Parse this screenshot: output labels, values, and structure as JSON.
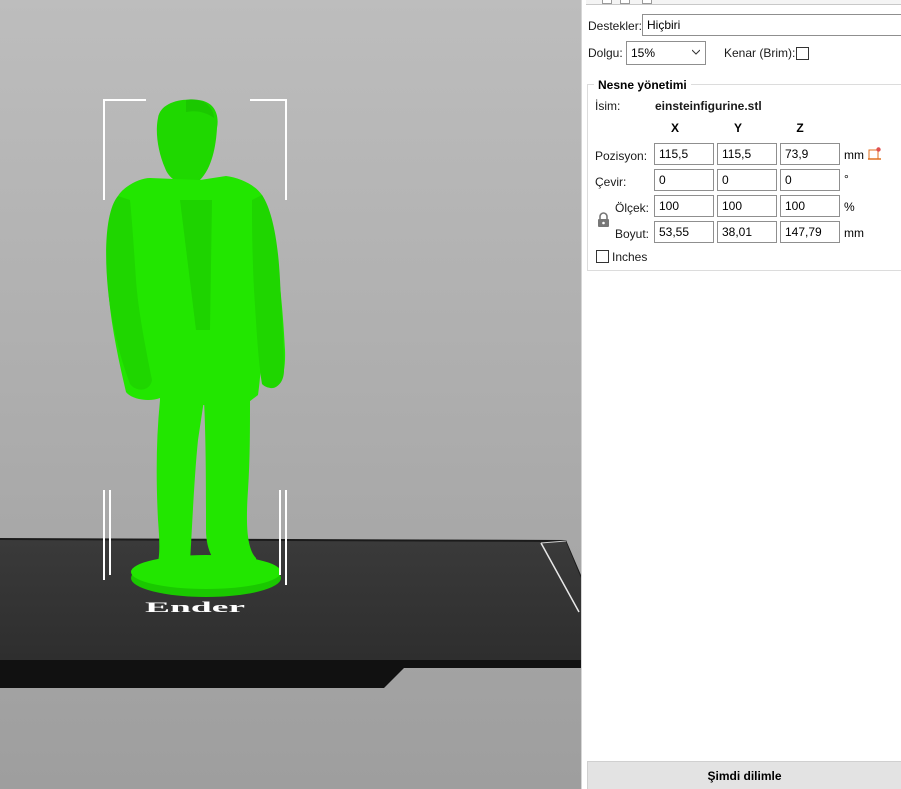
{
  "viewport": {
    "model_color": "#22e600",
    "bed_logo_text": "Ender"
  },
  "panel": {
    "supports": {
      "label": "Destekler:",
      "value": "Hiçbiri"
    },
    "infill": {
      "label": "Dolgu:",
      "value": "15%"
    },
    "brim": {
      "label": "Kenar (Brim):",
      "checked": false
    },
    "object_management": {
      "title": "Nesne yönetimi",
      "name_label": "İsim:",
      "file_name": "einsteinfigurine.stl",
      "axis_headers": [
        "X",
        "Y",
        "Z"
      ],
      "position": {
        "label": "Pozisyon:",
        "x": "115,5",
        "y": "115,5",
        "z": "73,9",
        "unit": "mm"
      },
      "rotate": {
        "label": "Çevir:",
        "x": "0",
        "y": "0",
        "z": "0",
        "unit": "°"
      },
      "scale": {
        "label": "Ölçek:",
        "x": "100",
        "y": "100",
        "z": "100",
        "unit": "%"
      },
      "size": {
        "label": "Boyut:",
        "x": "53,55",
        "y": "38,01",
        "z": "147,79",
        "unit": "mm"
      },
      "inches": {
        "label": "Inches",
        "checked": false
      }
    },
    "slice_button": "Şimdi dilimle"
  }
}
